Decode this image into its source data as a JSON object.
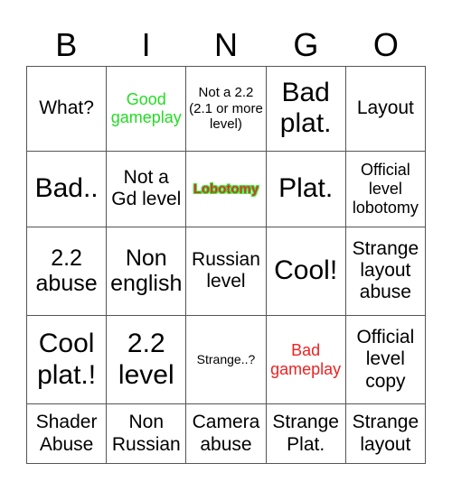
{
  "header": [
    "B",
    "I",
    "N",
    "G",
    "O"
  ],
  "colors": {
    "green": "#22dd22",
    "red": "#ee2222",
    "lobotomy_fill": "#dd3333",
    "lobotomy_outline": "#33ee33",
    "text": "#000000"
  },
  "cells": [
    [
      {
        "text": "What?",
        "size": "md",
        "color": "text"
      },
      {
        "text": "Good gameplay",
        "size": "sm",
        "color": "green"
      },
      {
        "text": "Not a 2.2 (2.1 or more level)",
        "size": "xs",
        "color": "text"
      },
      {
        "text": "Bad plat.",
        "size": "xl",
        "color": "text"
      },
      {
        "text": "Layout",
        "size": "md",
        "color": "text"
      }
    ],
    [
      {
        "text": "Bad..",
        "size": "xl",
        "color": "text"
      },
      {
        "text": "Not a Gd level",
        "size": "md",
        "color": "text"
      },
      {
        "text": "Lobotomy",
        "size": "xs",
        "color": "lobotomy"
      },
      {
        "text": "Plat.",
        "size": "xl",
        "color": "text"
      },
      {
        "text": "Official level lobotomy",
        "size": "sm",
        "color": "text"
      }
    ],
    [
      {
        "text": "2.2 abuse",
        "size": "lg",
        "color": "text"
      },
      {
        "text": "Non english",
        "size": "lg",
        "color": "text"
      },
      {
        "text": "Russian level",
        "size": "md",
        "color": "text"
      },
      {
        "text": "Cool!",
        "size": "xl",
        "color": "text"
      },
      {
        "text": "Strange layout abuse",
        "size": "md",
        "color": "text"
      }
    ],
    [
      {
        "text": "Cool plat.!",
        "size": "xl",
        "color": "text"
      },
      {
        "text": "2.2 level",
        "size": "xl",
        "color": "text"
      },
      {
        "text": "Strange..?",
        "size": "xxs",
        "color": "text"
      },
      {
        "text": "Bad gameplay",
        "size": "sm",
        "color": "red"
      },
      {
        "text": "Official level copy",
        "size": "md",
        "color": "text"
      }
    ],
    [
      {
        "text": "Shader Abuse",
        "size": "md",
        "color": "text"
      },
      {
        "text": "Non Russian",
        "size": "md",
        "color": "text"
      },
      {
        "text": "Camera abuse",
        "size": "md",
        "color": "text"
      },
      {
        "text": "Strange Plat.",
        "size": "md",
        "color": "text"
      },
      {
        "text": "Strange layout",
        "size": "md",
        "color": "text"
      }
    ]
  ]
}
